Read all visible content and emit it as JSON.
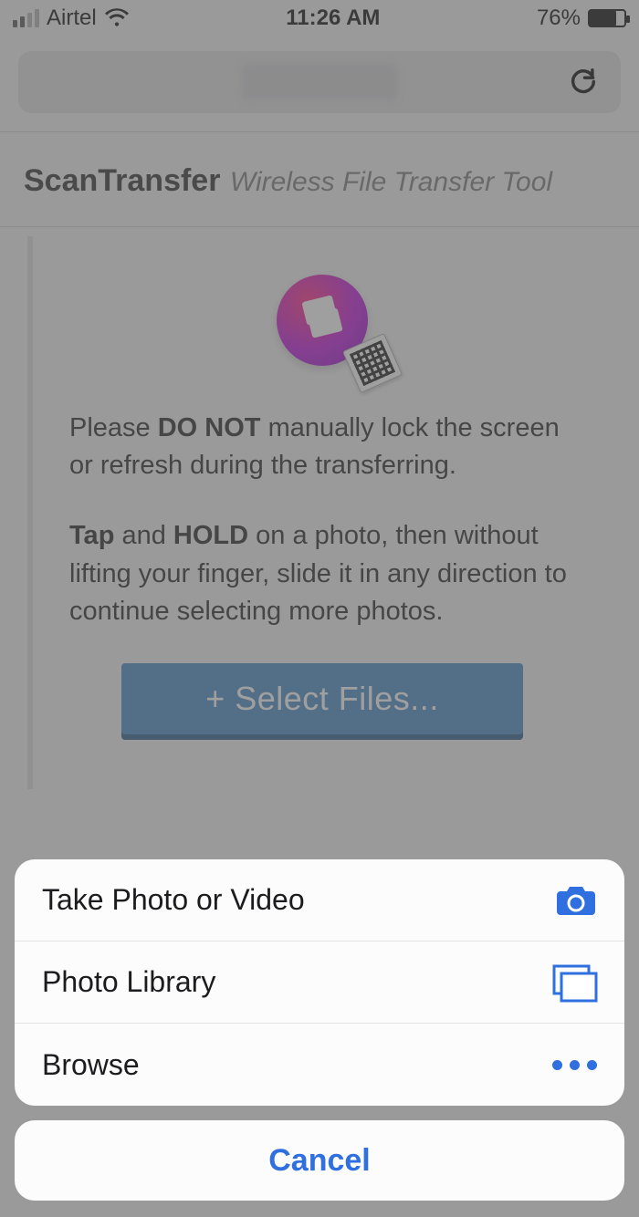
{
  "status": {
    "carrier": "Airtel",
    "time": "11:26 AM",
    "battery_pct": "76%",
    "battery_level": 76
  },
  "header": {
    "brand": "ScanTransfer",
    "tagline": "Wireless File Transfer Tool"
  },
  "instructions": {
    "line1_pre": "Please ",
    "line1_bold": "DO NOT",
    "line1_post": " manually lock the screen or refresh during the transferring.",
    "line2_b1": "Tap",
    "line2_mid1": " and ",
    "line2_b2": "HOLD",
    "line2_post": " on a photo, then without lifting your finger, slide it in any direction to continue selecting more photos."
  },
  "select_button": "+ Select Files...",
  "sheet": {
    "take_photo": "Take Photo or Video",
    "photo_library": "Photo Library",
    "browse": "Browse",
    "cancel": "Cancel"
  },
  "colors": {
    "accent_blue": "#2f6fe0",
    "button_blue": "#5792c9"
  }
}
